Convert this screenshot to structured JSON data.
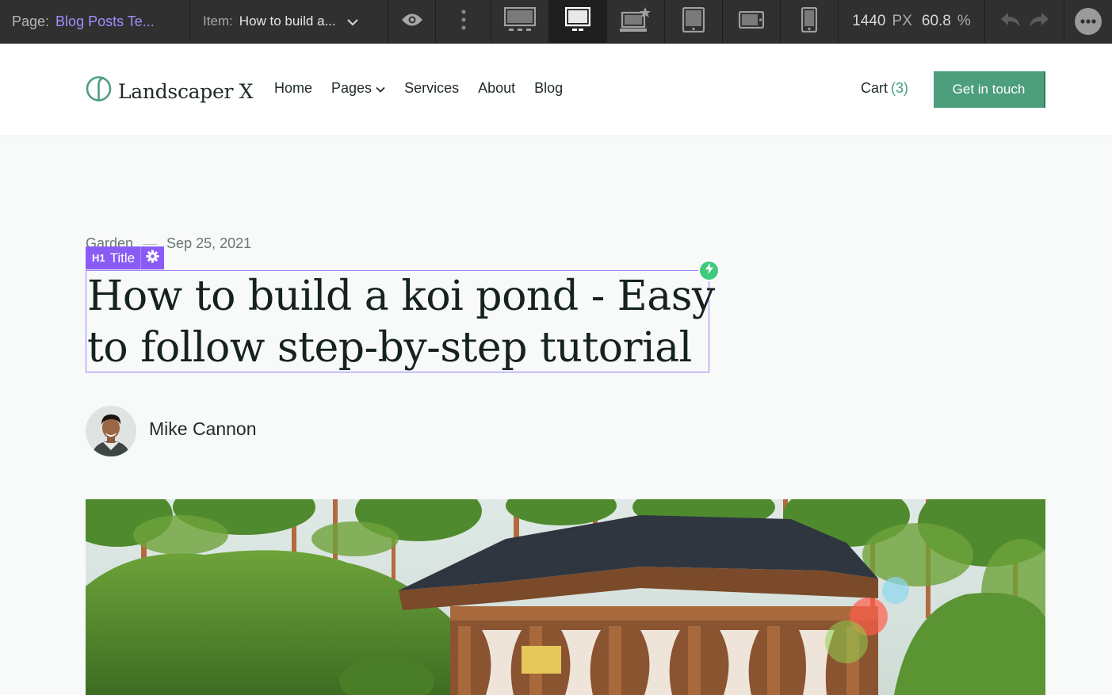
{
  "editor": {
    "page_label": "Page:",
    "page_value": "Blog Posts Te...",
    "item_label": "Item:",
    "item_value": "How to build a...",
    "width_value": "1440",
    "width_unit": "PX",
    "zoom_value": "60.8",
    "zoom_unit": "%",
    "devices": [
      "desktop-large-icon",
      "desktop-icon",
      "desktop-custom-icon",
      "tablet-icon",
      "tablet-landscape-icon",
      "phone-icon"
    ],
    "active_device": "desktop-icon"
  },
  "site": {
    "logo_text": "Landscaper X",
    "nav": {
      "home": "Home",
      "pages": "Pages",
      "services": "Services",
      "about": "About",
      "blog": "Blog"
    },
    "cart_label": "Cart",
    "cart_count": "(3)",
    "cta_label": "Get in touch"
  },
  "post": {
    "category": "Garden",
    "date": "Sep 25, 2021",
    "selection_tag_type": "H1",
    "selection_tag_label": "Title",
    "title_line1": "How to build a koi pond - Easy",
    "title_line2": "to follow step-by-step tutorial",
    "author": "Mike Cannon"
  },
  "colors": {
    "accent_purple": "#8a5cf6",
    "brand_green": "#4d9e7c",
    "bolt_green": "#3fc97c"
  }
}
